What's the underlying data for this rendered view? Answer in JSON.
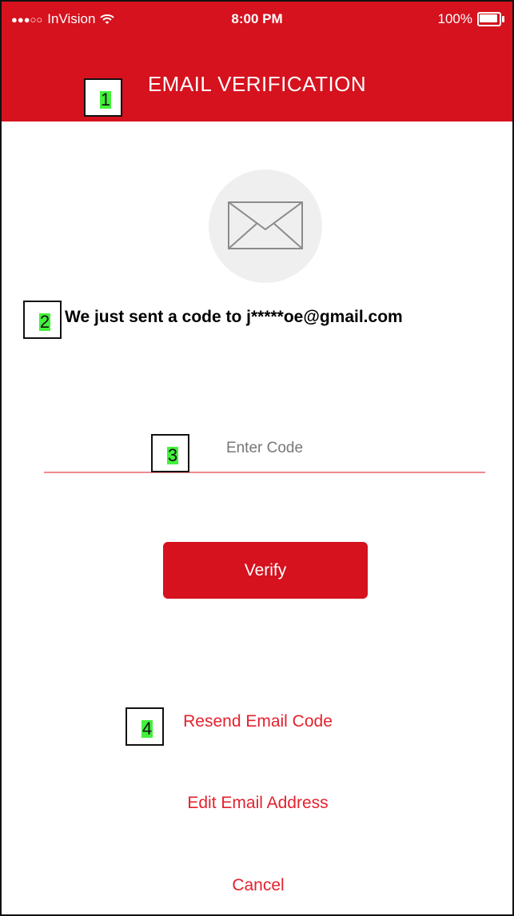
{
  "status_bar": {
    "carrier": "InVision",
    "signal": "●●●○○",
    "time": "8:00 PM",
    "battery": "100%",
    "battery_level": 1.0,
    "wifi_icon": "wifi-icon",
    "battery_icon": "battery-icon"
  },
  "header": {
    "title": "EMAIL VERIFICATION",
    "color": "#d5121e"
  },
  "content": {
    "email_icon": "envelope-icon",
    "message": "We just sent a code to j*****oe@gmail.com",
    "code_placeholder": "Enter Code",
    "verify_label": "Verify",
    "resend_label": "Resend Email Code",
    "edit_label": "Edit Email Address",
    "cancel_label": "Cancel",
    "accent_color": "#e4212d"
  },
  "markers": [
    {
      "label": "1"
    },
    {
      "label": "2"
    },
    {
      "label": "3"
    },
    {
      "label": "4"
    }
  ]
}
